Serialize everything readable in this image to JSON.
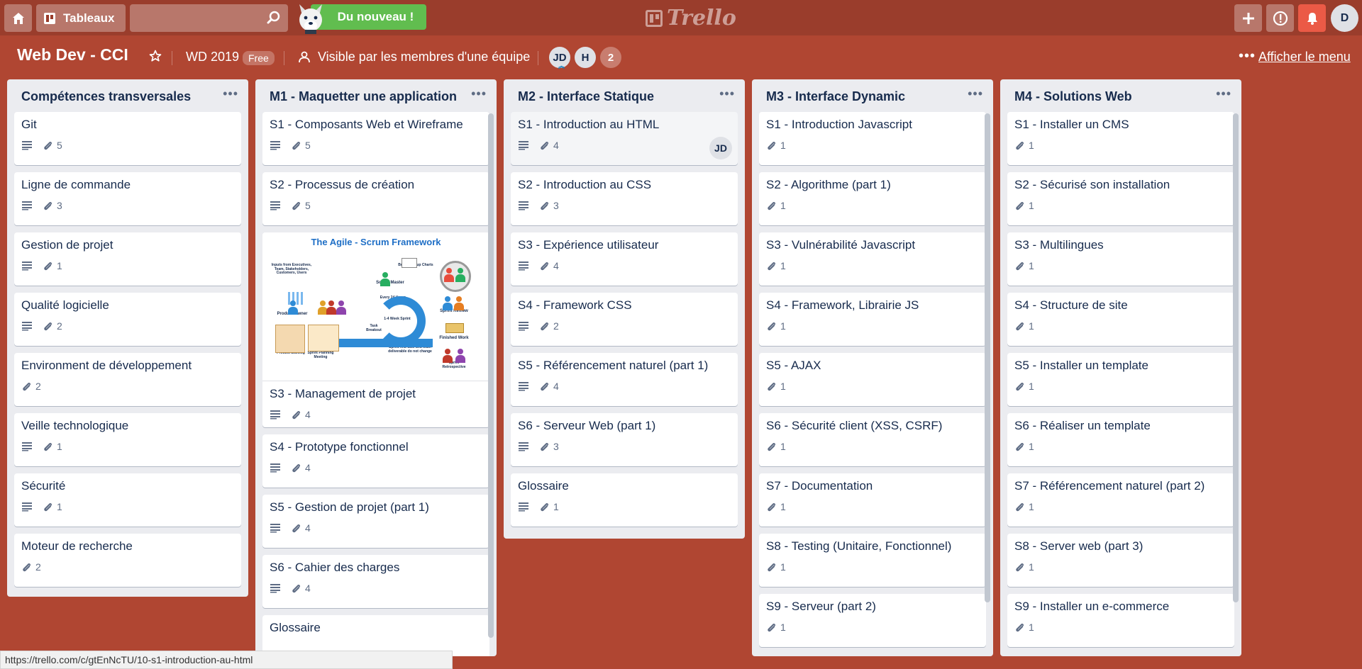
{
  "header": {
    "boards_label": "Tableaux",
    "search_placeholder": "",
    "news_label": "Du nouveau !",
    "logo_text": "Trello",
    "avatar_initial": "D"
  },
  "board": {
    "title": "Web Dev - CCI",
    "team": "WD 2019",
    "team_badge": "Free",
    "visibility": "Visible par les membres d'une équipe",
    "members": [
      "JD",
      "H",
      "2"
    ],
    "show_menu": "Afficher le menu"
  },
  "lists": [
    {
      "title": "Compétences transversales",
      "cards": [
        {
          "title": "Git",
          "desc": true,
          "attach": "5"
        },
        {
          "title": "Ligne de commande",
          "desc": true,
          "attach": "3"
        },
        {
          "title": "Gestion de projet",
          "desc": true,
          "attach": "1"
        },
        {
          "title": "Qualité logicielle",
          "desc": true,
          "attach": "2"
        },
        {
          "title": "Environment de développement",
          "desc": false,
          "attach": "2"
        },
        {
          "title": "Veille technologique",
          "desc": true,
          "attach": "1"
        },
        {
          "title": "Sécurité",
          "desc": true,
          "attach": "1"
        },
        {
          "title": "Moteur de recherche",
          "desc": false,
          "attach": "2"
        }
      ]
    },
    {
      "title": "M1 - Maquetter une application",
      "cards": [
        {
          "title": "S1 - Composants Web et Wireframe",
          "desc": true,
          "attach": "5"
        },
        {
          "title": "S2 - Processus de création",
          "desc": true,
          "attach": "5"
        },
        {
          "title": "S3 - Management de projet",
          "desc": true,
          "attach": "4",
          "cover": true
        },
        {
          "title": "S4 - Prototype fonctionnel",
          "desc": true,
          "attach": "4"
        },
        {
          "title": "S5 - Gestion de projet (part 1)",
          "desc": true,
          "attach": "4"
        },
        {
          "title": "S6 - Cahier des charges",
          "desc": true,
          "attach": "4"
        },
        {
          "title": "Glossaire",
          "desc": false,
          "attach": ""
        }
      ],
      "cover": {
        "title": "The Agile - Scrum Framework",
        "labels": [
          "Inputs from Executives, Team, Stakeholders, Customers, Users",
          "Product Owner",
          "The Team",
          "Scrum Master",
          "Burndown/up Charts",
          "Daily Scrum Meeting",
          "Every 24 Hours",
          "1-4 Week Sprint",
          "Sprint Review",
          "Product Backlog",
          "Sprint Planning Meeting",
          "Sprint Backlog",
          "Task Breakout",
          "Finished Work",
          "Sprint Retrospective",
          "Sprint end date and team deliverable do not change"
        ]
      }
    },
    {
      "title": "M2 - Interface Statique",
      "cards": [
        {
          "title": "S1 - Introduction au HTML",
          "desc": true,
          "attach": "4",
          "member": "JD"
        },
        {
          "title": "S2 - Introduction au CSS",
          "desc": true,
          "attach": "3"
        },
        {
          "title": "S3 - Expérience utilisateur",
          "desc": true,
          "attach": "4"
        },
        {
          "title": "S4 - Framework CSS",
          "desc": true,
          "attach": "2"
        },
        {
          "title": "S5 - Référencement naturel (part 1)",
          "desc": true,
          "attach": "4"
        },
        {
          "title": "S6 - Serveur Web (part 1)",
          "desc": true,
          "attach": "3"
        },
        {
          "title": "Glossaire",
          "desc": true,
          "attach": "1"
        }
      ]
    },
    {
      "title": "M3 - Interface Dynamic",
      "cards": [
        {
          "title": "S1 - Introduction Javascript",
          "desc": false,
          "attach": "1"
        },
        {
          "title": "S2 - Algorithme (part 1)",
          "desc": false,
          "attach": "1"
        },
        {
          "title": "S3 - Vulnérabilité Javascript",
          "desc": false,
          "attach": "1"
        },
        {
          "title": "S4 - Framework, Librairie JS",
          "desc": false,
          "attach": "1"
        },
        {
          "title": "S5 - AJAX",
          "desc": false,
          "attach": "1"
        },
        {
          "title": "S6 - Sécurité client (XSS, CSRF)",
          "desc": false,
          "attach": "1"
        },
        {
          "title": "S7 - Documentation",
          "desc": false,
          "attach": "1"
        },
        {
          "title": "S8 - Testing (Unitaire, Fonctionnel)",
          "desc": false,
          "attach": "1"
        },
        {
          "title": "S9 - Serveur (part 2)",
          "desc": false,
          "attach": "1"
        }
      ]
    },
    {
      "title": "M4 - Solutions Web",
      "cards": [
        {
          "title": "S1 - Installer un CMS",
          "desc": false,
          "attach": "1"
        },
        {
          "title": "S2 - Sécurisé son installation",
          "desc": false,
          "attach": "1"
        },
        {
          "title": "S3 - Multilingues",
          "desc": false,
          "attach": "1"
        },
        {
          "title": "S4 - Structure de site",
          "desc": false,
          "attach": "1"
        },
        {
          "title": "S5 - Installer un template",
          "desc": false,
          "attach": "1"
        },
        {
          "title": "S6 - Réaliser un template",
          "desc": false,
          "attach": "1"
        },
        {
          "title": "S7 - Référencement naturel (part 2)",
          "desc": false,
          "attach": "1"
        },
        {
          "title": "S8 - Server web (part 3)",
          "desc": false,
          "attach": "1"
        },
        {
          "title": "S9 - Installer un e-commerce",
          "desc": false,
          "attach": "1"
        }
      ]
    }
  ],
  "status_url": "https://trello.com/c/gtEnNcTU/10-s1-introduction-au-html",
  "colors": {
    "board_bg": "#b04632",
    "header_bg": "#9a3d2c",
    "list_bg": "#ebecf0",
    "news_green": "#61bd4f",
    "notif_red": "#eb5a46"
  }
}
